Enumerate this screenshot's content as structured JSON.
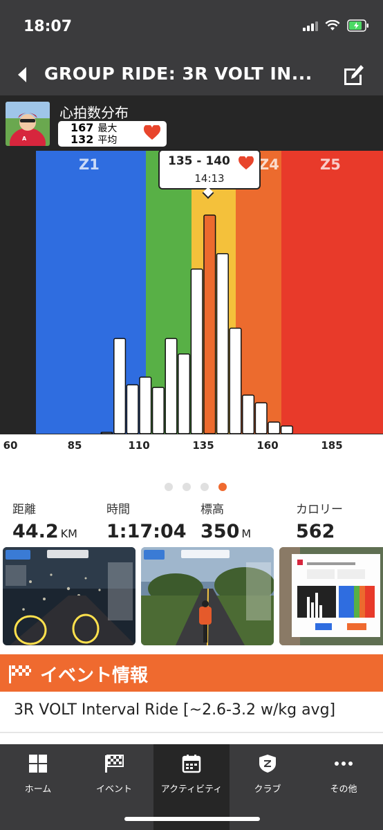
{
  "status_bar": {
    "time": "18:07"
  },
  "header": {
    "title": "GROUP RIDE: 3R VOLT IN..."
  },
  "heart_rate": {
    "title": "心拍数分布",
    "max_value": "167",
    "max_label": "最大",
    "avg_value": "132",
    "avg_label": "平均"
  },
  "tooltip": {
    "range": "135 - 140",
    "time": "14:13"
  },
  "zones": [
    "Z1",
    "Z4",
    "Z5"
  ],
  "chart_data": {
    "type": "bar",
    "title": "心拍数分布",
    "xlabel": "",
    "ylabel": "",
    "x_ticks": [
      60,
      85,
      110,
      135,
      160,
      185
    ],
    "xlim": [
      60,
      200
    ],
    "bin_width": 5,
    "bins": [
      {
        "start": 95,
        "value": 0.5
      },
      {
        "start": 100,
        "value": 37
      },
      {
        "start": 105,
        "value": 19
      },
      {
        "start": 110,
        "value": 22
      },
      {
        "start": 115,
        "value": 18
      },
      {
        "start": 120,
        "value": 37
      },
      {
        "start": 125,
        "value": 31
      },
      {
        "start": 130,
        "value": 64
      },
      {
        "start": 135,
        "value": 85
      },
      {
        "start": 140,
        "value": 70
      },
      {
        "start": 145,
        "value": 41
      },
      {
        "start": 150,
        "value": 15
      },
      {
        "start": 155,
        "value": 12
      },
      {
        "start": 160,
        "value": 4.5
      },
      {
        "start": 165,
        "value": 3
      }
    ],
    "highlight_bin": 135,
    "zone_bands": [
      {
        "name": "Z1",
        "color": "#2f6de0"
      },
      {
        "name": "Z2",
        "color": "#58b046"
      },
      {
        "name": "Z3",
        "color": "#f4c13b"
      },
      {
        "name": "Z4",
        "color": "#ec6b2e"
      },
      {
        "name": "Z5",
        "color": "#e83a2a"
      }
    ]
  },
  "pager": {
    "count": 4,
    "active": 3
  },
  "stats": [
    {
      "label": "距離",
      "value": "44.2",
      "unit": "KM"
    },
    {
      "label": "時間",
      "value": "1:17:04",
      "unit": ""
    },
    {
      "label": "標高",
      "value": "350",
      "unit": "M"
    },
    {
      "label": "カロリー",
      "value": "562",
      "unit": ""
    }
  ],
  "event": {
    "banner": "イベント情報",
    "name": "3R VOLT Interval Ride [~2.6-3.2 w/kg avg]"
  },
  "nav": [
    {
      "label": "ホーム",
      "icon": "home-icon"
    },
    {
      "label": "イベント",
      "icon": "flag-icon"
    },
    {
      "label": "アクティビティ",
      "icon": "calendar-icon"
    },
    {
      "label": "クラブ",
      "icon": "shield-icon"
    },
    {
      "label": "その他",
      "icon": "more-icon"
    }
  ],
  "colors": {
    "accent": "#ef6a2f",
    "header_bg": "#3b3b3d",
    "chart_bg": "#262626"
  }
}
